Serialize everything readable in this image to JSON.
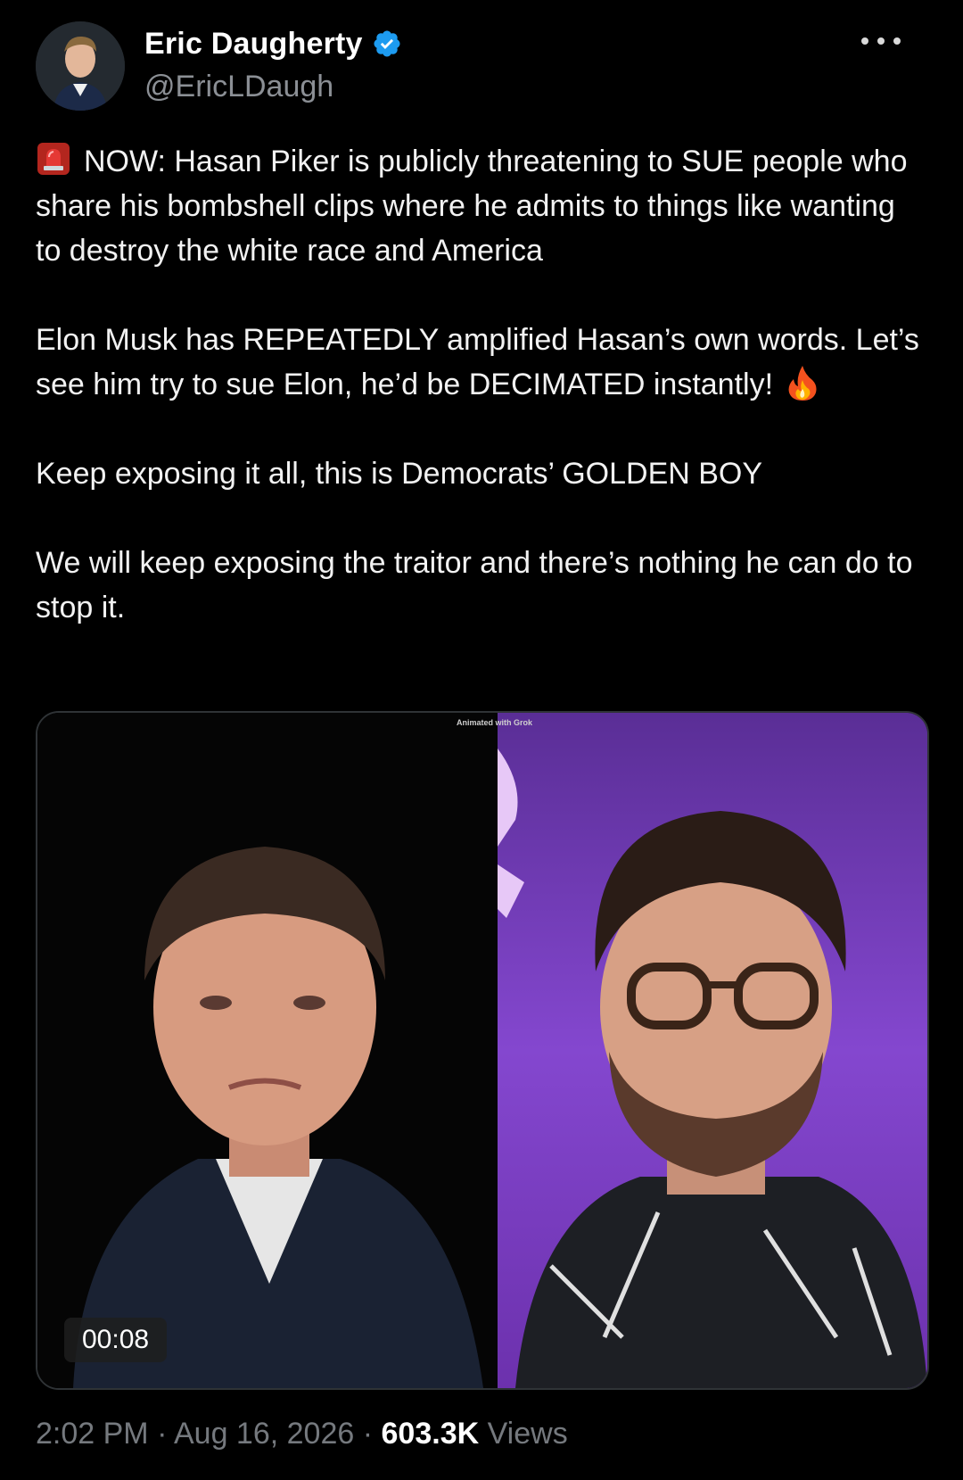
{
  "author": {
    "display_name": "Eric Daugherty",
    "handle": "@EricLDaugh",
    "verified": true,
    "verified_color": "#1d9bf0",
    "avatar_icon": "profile-photo"
  },
  "more_icon": "more-dots-icon",
  "tweet": {
    "paragraphs": [
      {
        "emoji": "rotating-light-emoji",
        "text": "NOW: Hasan Piker is publicly threatening to SUE people who share his bombshell clips where he admits to things like wanting to destroy the white race and America"
      },
      {
        "text": "Elon Musk has REPEATEDLY amplified Hasan’s own words. Let’s see him try to sue Elon, he’d be DECIMATED instantly!",
        "emoji_after": "fire-emoji"
      },
      {
        "text": "Keep exposing it all, this is Democrats’ GOLDEN BOY"
      },
      {
        "text": "We will keep exposing the traitor and there’s nothing he can do to stop it."
      }
    ]
  },
  "media": {
    "watermark": "Animated with Grok",
    "duration": "00:08",
    "left_panel_bg": "#050505",
    "right_panel_bg": "#7a3fc0"
  },
  "meta": {
    "time": "2:02 PM",
    "date": "Aug 16, 2026",
    "views_count": "603.3K",
    "views_label": "Views",
    "separator": "·"
  }
}
